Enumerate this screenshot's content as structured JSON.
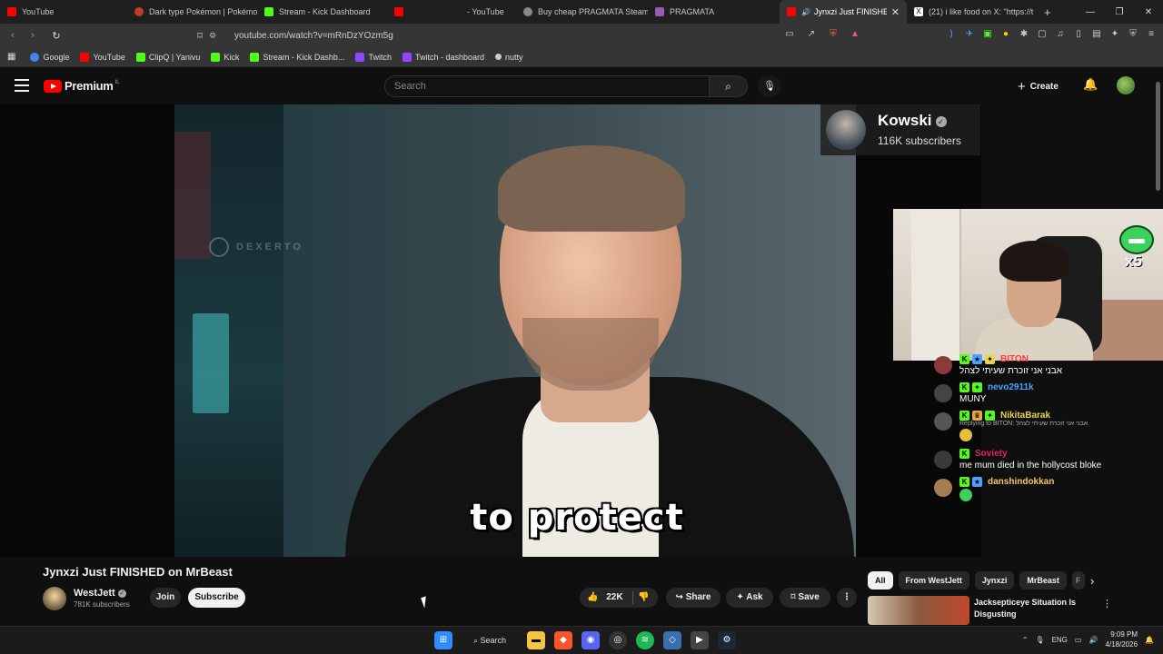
{
  "browser": {
    "tabs": [
      {
        "label": "YouTube",
        "color": "#ff0000"
      },
      {
        "label": "Dark type Pokémon | Pokémon",
        "color": "#c0392b"
      },
      {
        "label": "Stream - Kick Dashboard",
        "color": "#53fc18"
      },
      {
        "label": "",
        "color": "#ff0000"
      },
      {
        "label": "- YouTube",
        "color": "#ff0000"
      },
      {
        "label": "Buy cheap PRAGMATA Steam",
        "color": "#888888"
      },
      {
        "label": "PRAGMATA",
        "color": "#9b59b6"
      },
      {
        "label": "Jynxzi Just FINISHED on",
        "color": "#ff0000",
        "active": true
      },
      {
        "label": "(21) i like food on X: \"https://t",
        "color": "#ffffff"
      }
    ],
    "new_tab": "+",
    "window_controls": [
      "—",
      "❐",
      "✕"
    ],
    "url": "youtube.com/watch?v=mRnDzYOzm5g",
    "bookmarks": [
      {
        "label": "Google",
        "color": "#4285f4"
      },
      {
        "label": "YouTube",
        "color": "#ff0000"
      },
      {
        "label": "ClipQ | Yanivu",
        "color": "#53fc18"
      },
      {
        "label": "Kick",
        "color": "#53fc18"
      },
      {
        "label": "Stream - Kick Dashb...",
        "color": "#53fc18"
      },
      {
        "label": "Twitch",
        "color": "#9146ff"
      },
      {
        "label": "Twitch - dashboard",
        "color": "#9146ff"
      },
      {
        "label": "nutty",
        "color": "#cccccc"
      }
    ]
  },
  "youtube": {
    "logo_text": "Premium",
    "logo_country": "IL",
    "search_placeholder": "Search",
    "create_label": "Create"
  },
  "video": {
    "watermark": "DEXERTO",
    "caption": "to protect",
    "streamer_name": "Kowski",
    "streamer_subs": "116K subscribers",
    "emote_multiplier": "x5"
  },
  "chat": [
    {
      "user": "BITON",
      "user_color": "#ff3b3b",
      "badges": [
        "K",
        "✦"
      ],
      "text": "אבני אני זוכרת שעיתי לצהל",
      "avatar": "#8b3a3a"
    },
    {
      "user": "nevo2911k",
      "user_color": "#4aa3ff",
      "badges": [
        "K",
        "✦"
      ],
      "text": "MUNY",
      "avatar": "#444444"
    },
    {
      "user": "NikitaBarak",
      "user_color": "#e8d44d",
      "badges": [
        "K",
        "✦"
      ],
      "reply": "Replying to BITON: אבני אני זוכרת שעיתי לצהל",
      "text": "",
      "avatar": "#555555",
      "emote": true
    },
    {
      "user": "Soviety",
      "user_color": "#d92b5c",
      "badges": [
        "K"
      ],
      "text": "me mum died in the hollycost bloke",
      "avatar": "#3a3a3a"
    },
    {
      "user": "danshindokkan",
      "user_color": "#f5c66b",
      "badges": [
        "K",
        "✦"
      ],
      "text": "",
      "avatar": "#a67c52",
      "emote_green": true
    }
  ],
  "below": {
    "title": "Jynxzi Just FINISHED on MrBeast",
    "channel_name": "WestJett",
    "channel_subs": "781K subscribers",
    "join": "Join",
    "subscribe": "Subscribe",
    "likes": "22K",
    "share": "Share",
    "ask": "Ask",
    "save": "Save",
    "more": "⋮"
  },
  "sidebar": {
    "chips": [
      "All",
      "From WestJett",
      "Jynxzi",
      "MrBeast",
      "F"
    ],
    "rec_title": "Jacksepticeye Situation Is Disgusting"
  },
  "taskbar": {
    "search": "Search",
    "lang": "ENG",
    "time": "9:09 PM",
    "date": "4/18/2026"
  }
}
